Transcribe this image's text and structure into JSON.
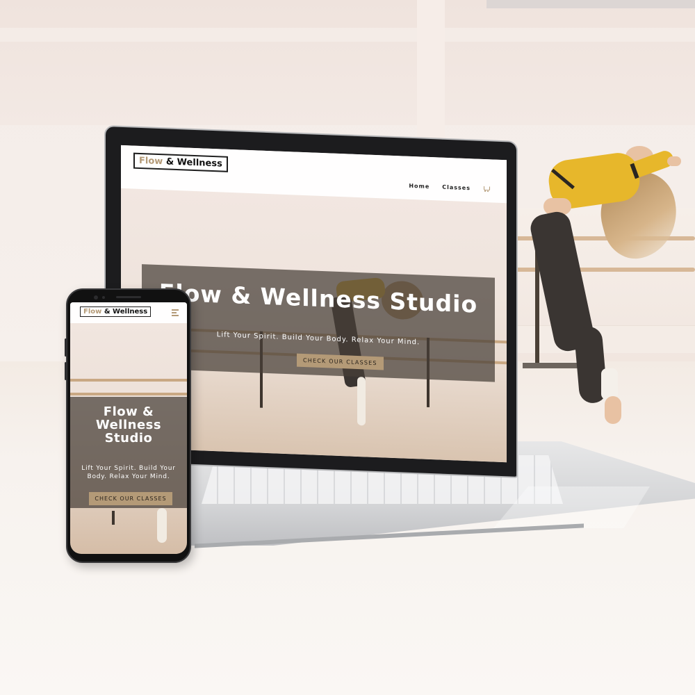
{
  "site": {
    "logo_flow": "Flow",
    "logo_rest": "& Wellness",
    "nav": {
      "home": "Home",
      "classes": "Classes"
    },
    "hero": {
      "title": "Flow & Wellness Studio",
      "subtitle": "Lift Your Spirit. Build Your Body. Relax Your Mind.",
      "button": "CHECK OUR CLASSES"
    }
  },
  "mobile": {
    "title": "Flow & Wellness Studio",
    "subtitle": "Lift Your Spirit. Build Your Body. Relax Your Mind.",
    "button": "CHECK OUR CLASSES"
  },
  "icons": {
    "cart": "cart-icon",
    "menu": "hamburger-menu-icon"
  },
  "colors": {
    "accent": "#b49a77",
    "overlay": "#463e38",
    "dancer_top": "#e7b72b"
  }
}
